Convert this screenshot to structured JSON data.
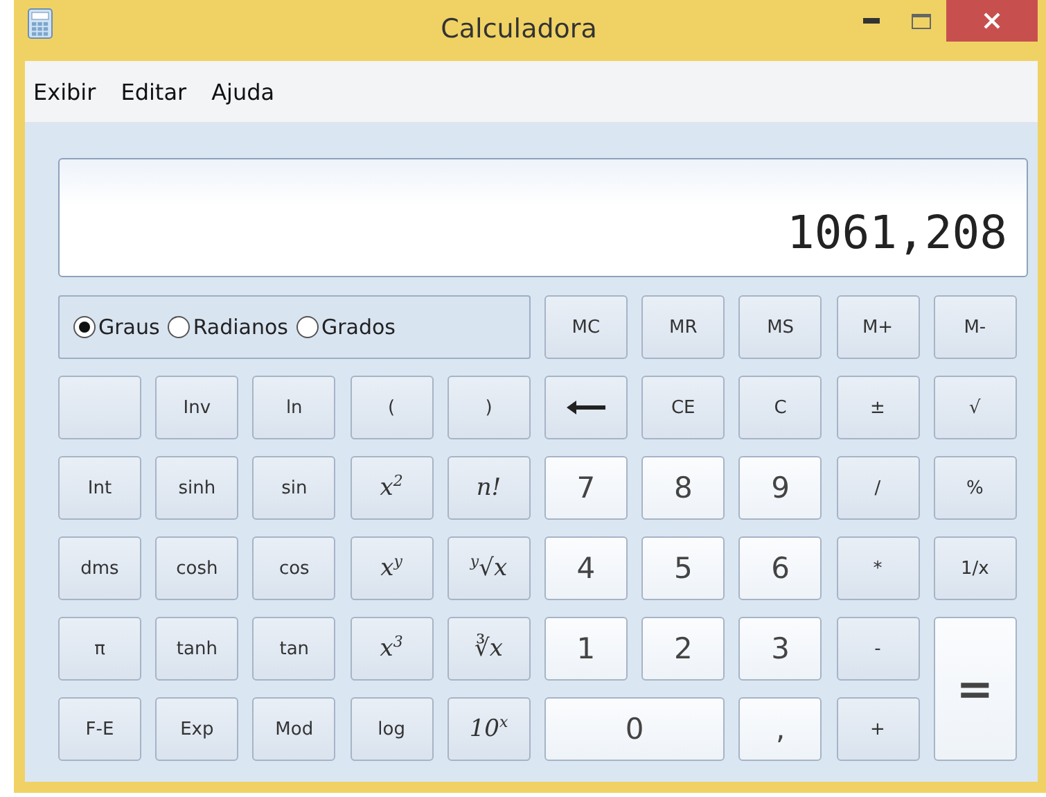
{
  "window": {
    "title": "Calculadora"
  },
  "menu": [
    "Exibir",
    "Editar",
    "Ajuda"
  ],
  "display": {
    "value": "1061,208"
  },
  "angle_modes": [
    {
      "label": "Graus",
      "selected": true
    },
    {
      "label": "Radianos",
      "selected": false
    },
    {
      "label": "Grados",
      "selected": false
    }
  ],
  "keys": [
    {
      "label": "MC",
      "kind": "func"
    },
    {
      "label": "MR",
      "kind": "func"
    },
    {
      "label": "MS",
      "kind": "func"
    },
    {
      "label": "M+",
      "kind": "func"
    },
    {
      "label": "M-",
      "kind": "func"
    },
    {
      "kind": "blank"
    },
    {
      "label": "Inv",
      "kind": "func"
    },
    {
      "label": "ln",
      "kind": "func"
    },
    {
      "label": "(",
      "kind": "func"
    },
    {
      "label": ")",
      "kind": "func"
    },
    {
      "kind": "backspace"
    },
    {
      "label": "CE",
      "kind": "func"
    },
    {
      "label": "C",
      "kind": "func"
    },
    {
      "label": "±",
      "kind": "func"
    },
    {
      "label": "√",
      "kind": "func"
    },
    {
      "label": "Int",
      "kind": "func"
    },
    {
      "label": "sinh",
      "kind": "func"
    },
    {
      "label": "sin",
      "kind": "func"
    },
    {
      "label": "x$^{2}$",
      "kind": "math"
    },
    {
      "label": "n!",
      "kind": "math"
    },
    {
      "label": "7",
      "kind": "digit"
    },
    {
      "label": "8",
      "kind": "digit"
    },
    {
      "label": "9",
      "kind": "digit"
    },
    {
      "label": "/",
      "kind": "func"
    },
    {
      "label": "%",
      "kind": "func"
    },
    {
      "label": "dms",
      "kind": "func"
    },
    {
      "label": "cosh",
      "kind": "func"
    },
    {
      "label": "cos",
      "kind": "func"
    },
    {
      "label": "x$^{y}$",
      "kind": "math"
    },
    {
      "label": "$^{y}$√x",
      "kind": "math"
    },
    {
      "label": "4",
      "kind": "digit"
    },
    {
      "label": "5",
      "kind": "digit"
    },
    {
      "label": "6",
      "kind": "digit"
    },
    {
      "label": "*",
      "kind": "func"
    },
    {
      "label": "1/x",
      "kind": "func"
    },
    {
      "label": "π",
      "kind": "func"
    },
    {
      "label": "tanh",
      "kind": "func"
    },
    {
      "label": "tan",
      "kind": "func"
    },
    {
      "label": "x$^{3}$",
      "kind": "math"
    },
    {
      "label": "∛x",
      "kind": "math"
    },
    {
      "label": "1",
      "kind": "digit"
    },
    {
      "label": "2",
      "kind": "digit"
    },
    {
      "label": "3",
      "kind": "digit"
    },
    {
      "label": "-",
      "kind": "func"
    },
    {
      "label": "=",
      "kind": "equals"
    },
    {
      "label": "F-E",
      "kind": "func"
    },
    {
      "label": "Exp",
      "kind": "func"
    },
    {
      "label": "Mod",
      "kind": "func"
    },
    {
      "label": "log",
      "kind": "func"
    },
    {
      "label": "10$^{x}$",
      "kind": "math"
    },
    {
      "label": "0",
      "kind": "zero"
    },
    {
      "label": ",",
      "kind": "digit"
    },
    {
      "label": "+",
      "kind": "func"
    }
  ]
}
